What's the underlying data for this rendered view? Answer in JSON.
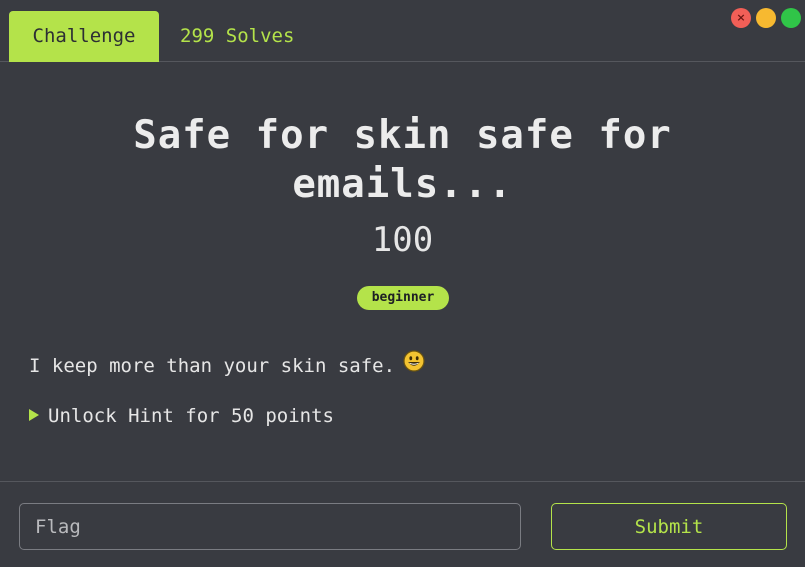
{
  "tabs": {
    "active_label": "Challenge",
    "solves_label": "299 Solves"
  },
  "window_controls": {
    "close_glyph": "×",
    "icons": [
      "close-icon",
      "minimize-icon",
      "maximize-icon"
    ],
    "colors": {
      "close": "#f15f57",
      "minimize": "#f7b930",
      "maximize": "#30c548"
    }
  },
  "challenge": {
    "title": "Safe for skin safe for emails...",
    "points": "100",
    "category": "beginner",
    "description": "I keep more than your skin safe.",
    "description_emoji": "grinning-face-emoji",
    "hint_label": "Unlock Hint for 50 points"
  },
  "form": {
    "flag_placeholder": "Flag",
    "flag_value": "",
    "submit_label": "Submit"
  },
  "colors": {
    "accent": "#b4e34a",
    "background": "#393b41",
    "text": "#e6e6e6"
  }
}
